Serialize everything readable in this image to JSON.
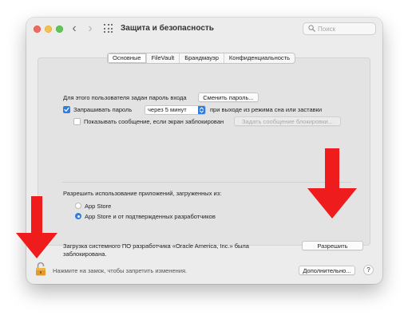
{
  "window": {
    "title": "Защита и безопасность",
    "search_placeholder": "Поиск"
  },
  "tabs": [
    {
      "label": "Основные",
      "active": true
    },
    {
      "label": "FileVault",
      "active": false
    },
    {
      "label": "Брандмауэр",
      "active": false
    },
    {
      "label": "Конфиденциальность",
      "active": false
    }
  ],
  "general": {
    "password_label": "Для этого пользователя задан пароль входа",
    "change_password_button": "Сменить пароль...",
    "require_password_label": "Запрашивать пароль",
    "require_password_checked": true,
    "require_password_delay": "через 5 минут",
    "require_password_suffix": "при выходе из режима сна или заставки",
    "show_message_label": "Показывать сообщение, если экран заблокирован",
    "show_message_checked": false,
    "set_message_button": "Задать сообщение блокировки..."
  },
  "apps": {
    "allow_label": "Разрешить использование приложений, загруженных из:",
    "options": [
      {
        "label": "App Store",
        "selected": false
      },
      {
        "label": "App Store и от подтвержденных разработчиков",
        "selected": true
      }
    ],
    "blocked_line1": "Загрузка системного ПО разработчика «Oracle America, Inc.» была",
    "blocked_line2": "заблокирована.",
    "allow_button": "Разрешить"
  },
  "footer": {
    "lock_text": "Нажмите на замок, чтобы запретить изменения.",
    "advanced_button": "Дополнительно...",
    "help_label": "?"
  },
  "colors": {
    "accent": "#2f7de1",
    "arrow": "#ee1c1c",
    "lock": "#e39a2b"
  }
}
